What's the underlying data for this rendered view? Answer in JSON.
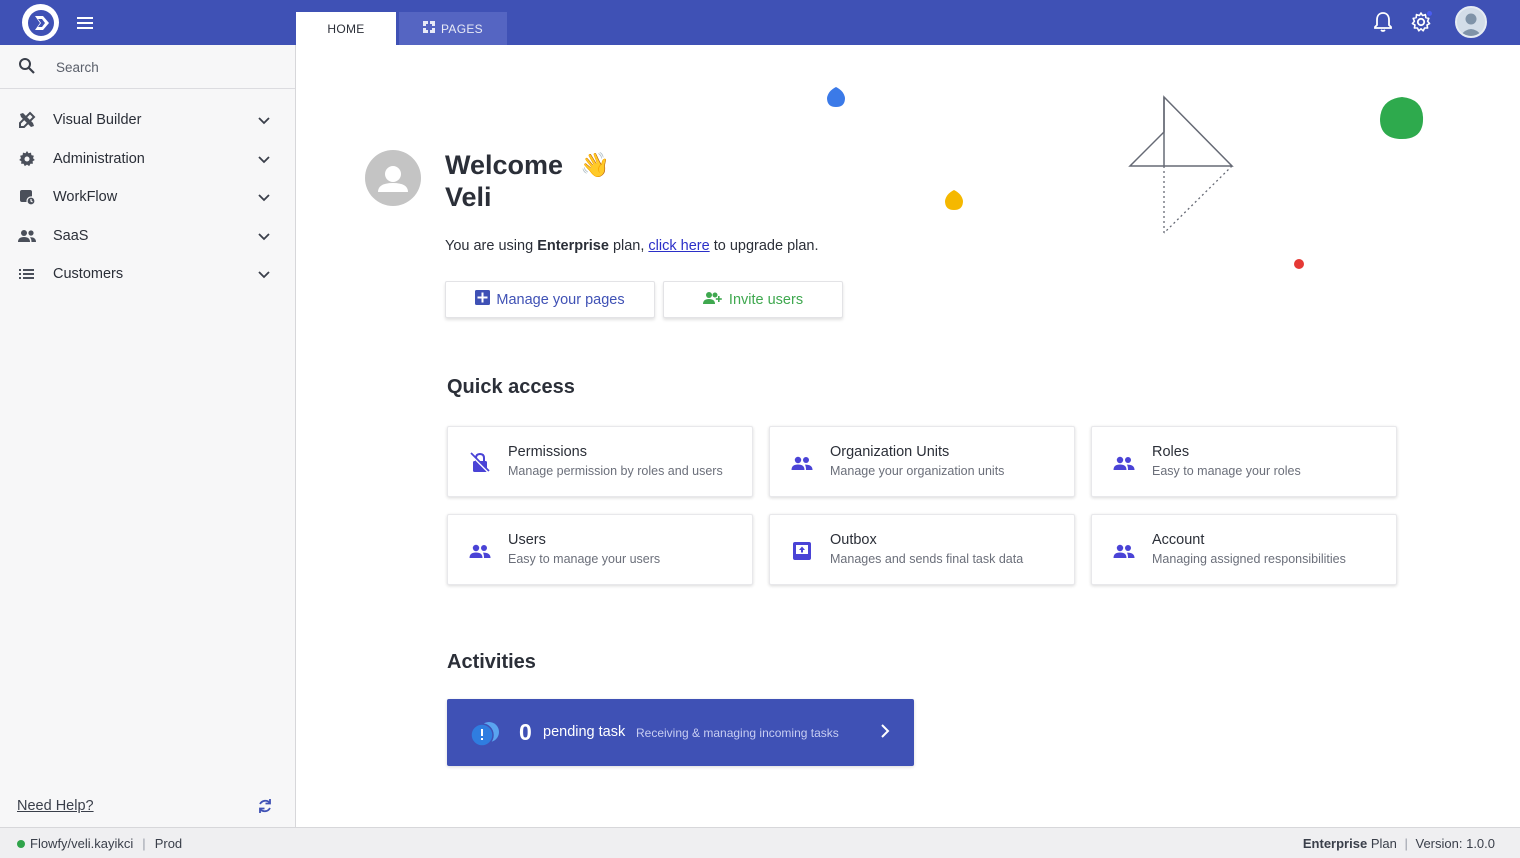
{
  "app": {
    "tabs": [
      {
        "label": "HOME",
        "active": true
      },
      {
        "label": "PAGES",
        "active": false
      }
    ],
    "icons": {
      "logo": "flowfy-logo-icon",
      "menu": "hamburger-icon",
      "notifications": "bell-icon",
      "settings": "gear-icon",
      "user": "user-avatar-icon"
    },
    "colors": {
      "primary": "#3f51b5",
      "accent_green": "#3fa84f",
      "status_green": "#2fa34a"
    }
  },
  "sidebar": {
    "search_placeholder": "Search",
    "items": [
      {
        "label": "Visual Builder",
        "icon": "tools-icon"
      },
      {
        "label": "Administration",
        "icon": "gear-icon"
      },
      {
        "label": "WorkFlow",
        "icon": "workflow-icon"
      },
      {
        "label": "SaaS",
        "icon": "people-icon"
      },
      {
        "label": "Customers",
        "icon": "list-icon"
      }
    ],
    "need_help": "Need Help?"
  },
  "main": {
    "welcome": "Welcome",
    "user_name": "Veli",
    "wave_emoji": "👋",
    "plan_prefix": "You are using ",
    "plan_name": "Enterprise",
    "plan_mid": " plan, ",
    "upgrade_link": "click here",
    "plan_suffix": " to upgrade plan.",
    "manage_pages_label": "Manage your pages",
    "invite_users_label": "Invite users",
    "quick_access_title": "Quick access",
    "quick_access": [
      {
        "title": "Permissions",
        "subtitle": "Manage permission by roles and users",
        "icon": "lock-icon"
      },
      {
        "title": "Organization Units",
        "subtitle": "Manage your organization units",
        "icon": "people-icon"
      },
      {
        "title": "Roles",
        "subtitle": "Easy to manage your roles",
        "icon": "people-icon"
      },
      {
        "title": "Users",
        "subtitle": "Easy to manage your users",
        "icon": "people-icon"
      },
      {
        "title": "Outbox",
        "subtitle": "Manages and sends final task data",
        "icon": "outbox-icon"
      },
      {
        "title": "Account",
        "subtitle": "Managing assigned responsibilities",
        "icon": "people-icon"
      }
    ],
    "activities_title": "Activities",
    "pending_count": "0",
    "pending_label": "pending task",
    "pending_sub": "Receiving & managing incoming tasks"
  },
  "status": {
    "workspace": "Flowfy/veli.kayikci",
    "env": "Prod",
    "plan_name": "Enterprise",
    "plan_word": "Plan",
    "version": "Version: 1.0.0"
  }
}
